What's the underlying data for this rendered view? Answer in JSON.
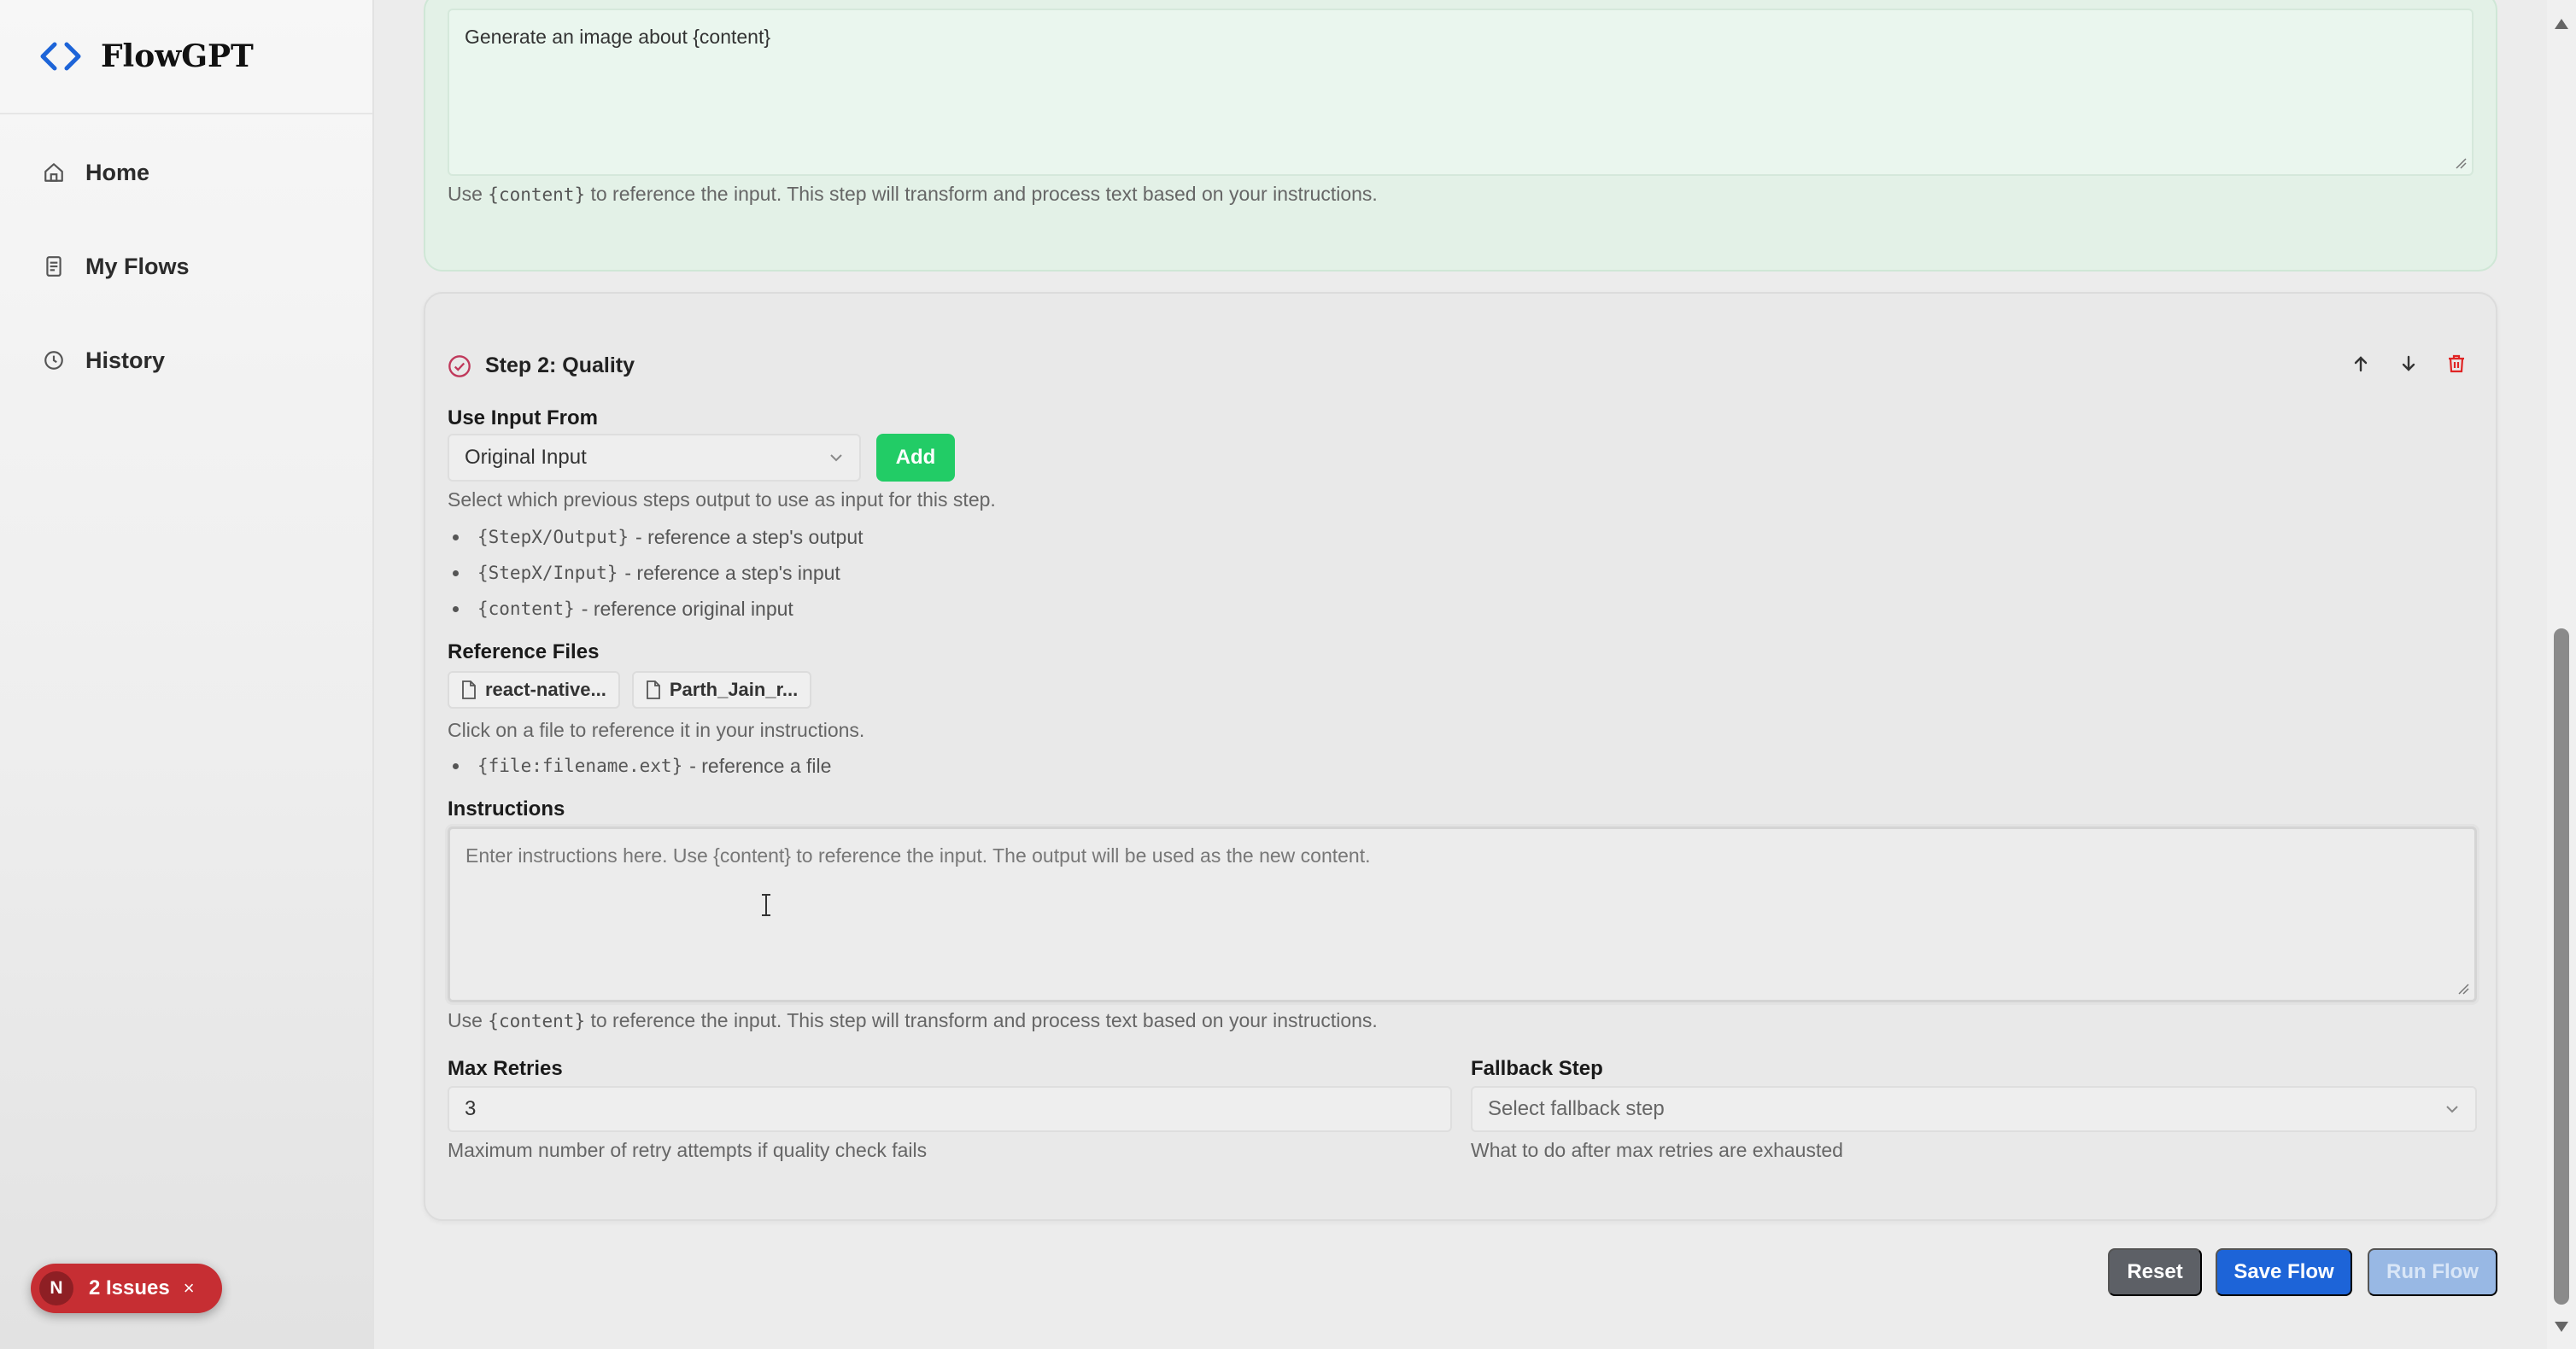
{
  "brand": {
    "name": "FlowGPT"
  },
  "sidebar": {
    "items": [
      {
        "label": "Home",
        "icon": "home-icon"
      },
      {
        "label": "My Flows",
        "icon": "document-icon"
      },
      {
        "label": "History",
        "icon": "clock-icon"
      }
    ]
  },
  "issues": {
    "badge": "N",
    "label": "2 Issues",
    "close": "×"
  },
  "step1": {
    "instructions_value": "Generate an image about {content}",
    "helper_prefix": "Use",
    "helper_code": "{content}",
    "helper_suffix": "to reference the input. This step will transform and process text based on your instructions."
  },
  "step2": {
    "title": "Step 2: Quality",
    "use_input_label": "Use Input From",
    "input_select_value": "Original Input",
    "add_label": "Add",
    "input_helper": "Select which previous steps output to use as input for this step.",
    "refs": [
      {
        "code": "{StepX/Output}",
        "text": "- reference a step's output"
      },
      {
        "code": "{StepX/Input}",
        "text": "- reference a step's input"
      },
      {
        "code": "{content}",
        "text": "- reference original input"
      }
    ],
    "files_label": "Reference Files",
    "files": [
      "react-native...",
      "Parth_Jain_r..."
    ],
    "files_helper": "Click on a file to reference it in your instructions.",
    "file_ref": {
      "code": "{file:filename.ext}",
      "text": "- reference a file"
    },
    "instructions_label": "Instructions",
    "instructions_placeholder": "Enter instructions here. Use {content} to reference the input. The output will be used as the new content.",
    "helper_prefix": "Use",
    "helper_code": "{content}",
    "helper_suffix": "to reference the input. This step will transform and process text based on your instructions.",
    "max_retries_label": "Max Retries",
    "max_retries_value": "3",
    "max_retries_helper": "Maximum number of retry attempts if quality check fails",
    "fallback_label": "Fallback Step",
    "fallback_placeholder": "Select fallback step",
    "fallback_helper": "What to do after max retries are exhausted"
  },
  "footer": {
    "reset": "Reset",
    "save": "Save Flow",
    "run": "Run Flow"
  },
  "colors": {
    "accent": "#1d64d8",
    "add": "#22cc66",
    "delete": "#e02424",
    "issues": "#c62e33"
  }
}
